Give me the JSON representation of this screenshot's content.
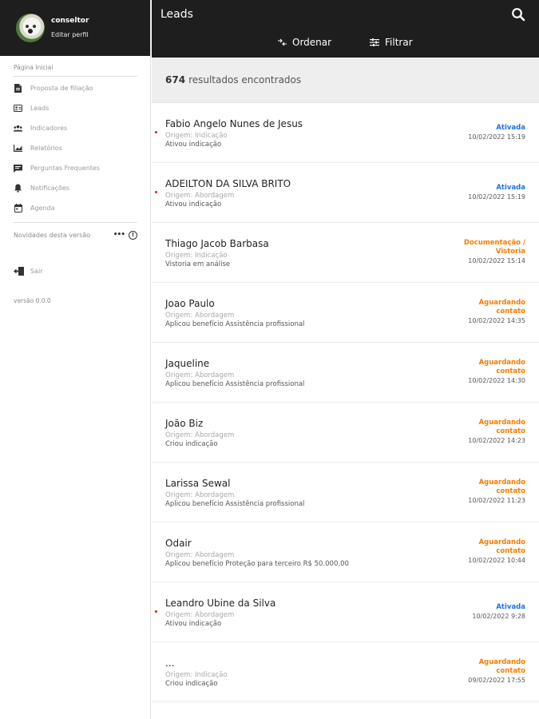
{
  "sidebar": {
    "username": "conseltor",
    "edit_profile": "Editar perfil",
    "section_label": "Página Inicial",
    "menu": [
      {
        "label": "Proposta de filiação",
        "icon": "document-icon"
      },
      {
        "label": "Leads",
        "icon": "contacts-icon"
      },
      {
        "label": "Indicadores",
        "icon": "group-icon"
      },
      {
        "label": "Relatórios",
        "icon": "chart-icon"
      },
      {
        "label": "Perguntas Frequentes",
        "icon": "chat-icon"
      },
      {
        "label": "Notificações",
        "icon": "bell-icon"
      },
      {
        "label": "Agenda",
        "icon": "calendar-icon"
      }
    ],
    "news_label": "Novidades desta versão",
    "news_dots": "•••",
    "news_info": "!",
    "exit_label": "Sair",
    "version": "versão 0.0.0"
  },
  "topbar": {
    "title": "Leads",
    "order_label": "Ordenar",
    "filter_label": "Filtrar"
  },
  "results": {
    "count": "674",
    "text": "resultados encontrados"
  },
  "status_colors": {
    "blue": "#1a73e8",
    "orange": "#f57c00"
  },
  "leads": [
    {
      "name": "Fabio Angelo Nunes de Jesus",
      "origin": "Origem: Indicação",
      "action": "Ativou indicação",
      "status": [
        "Ativada"
      ],
      "status_color": "blue",
      "date": "10/02/2022 15:19",
      "unread": true
    },
    {
      "name": "ADEILTON DA SILVA BRITO",
      "origin": "Origem: Abordagem",
      "action": "Ativou indicação",
      "status": [
        "Ativada"
      ],
      "status_color": "blue",
      "date": "10/02/2022 15:19",
      "unread": true
    },
    {
      "name": "Thiago Jacob Barbasa",
      "origin": "Origem: Indicação",
      "action": "Vistoria em análise",
      "status": [
        "Documentação /",
        "Vistoria"
      ],
      "status_color": "orange",
      "date": "10/02/2022 15:14",
      "unread": false
    },
    {
      "name": "Joao Paulo",
      "origin": "Origem: Abordagem",
      "action": "Aplicou benefício Assistência profissional",
      "status": [
        "Aguardando",
        "contato"
      ],
      "status_color": "orange",
      "date": "10/02/2022 14:35",
      "unread": false
    },
    {
      "name": "Jaqueline",
      "origin": "Origem: Abordagem",
      "action": "Aplicou benefício Assistência profissional",
      "status": [
        "Aguardando",
        "contato"
      ],
      "status_color": "orange",
      "date": "10/02/2022 14:30",
      "unread": false
    },
    {
      "name": "João Biz",
      "origin": "Origem: Abordagem",
      "action": "Criou indicação",
      "status": [
        "Aguardando",
        "contato"
      ],
      "status_color": "orange",
      "date": "10/02/2022 14:23",
      "unread": false
    },
    {
      "name": "Larissa Sewal",
      "origin": "Origem: Abordagem",
      "action": "Aplicou benefício Assistência profissional",
      "status": [
        "Aguardando",
        "contato"
      ],
      "status_color": "orange",
      "date": "10/02/2022 11:23",
      "unread": false
    },
    {
      "name": "Odair",
      "origin": "Origem: Abordagem",
      "action": "Aplicou benefício Proteção para terceiro R$ 50.000,00",
      "status": [
        "Aguardando",
        "contato"
      ],
      "status_color": "orange",
      "date": "10/02/2022 10:44",
      "unread": false
    },
    {
      "name": "Leandro Ubine da Silva",
      "origin": "Origem: Abordagem",
      "action": "Ativou indicação",
      "status": [
        "Ativada"
      ],
      "status_color": "blue",
      "date": "10/02/2022 9:28",
      "unread": true
    },
    {
      "name": "...",
      "origin": "Origem: Indicação",
      "action": "Criou indicação",
      "status": [
        "Aguardando",
        "contato"
      ],
      "status_color": "orange",
      "date": "09/02/2022 17:55",
      "unread": false
    }
  ]
}
